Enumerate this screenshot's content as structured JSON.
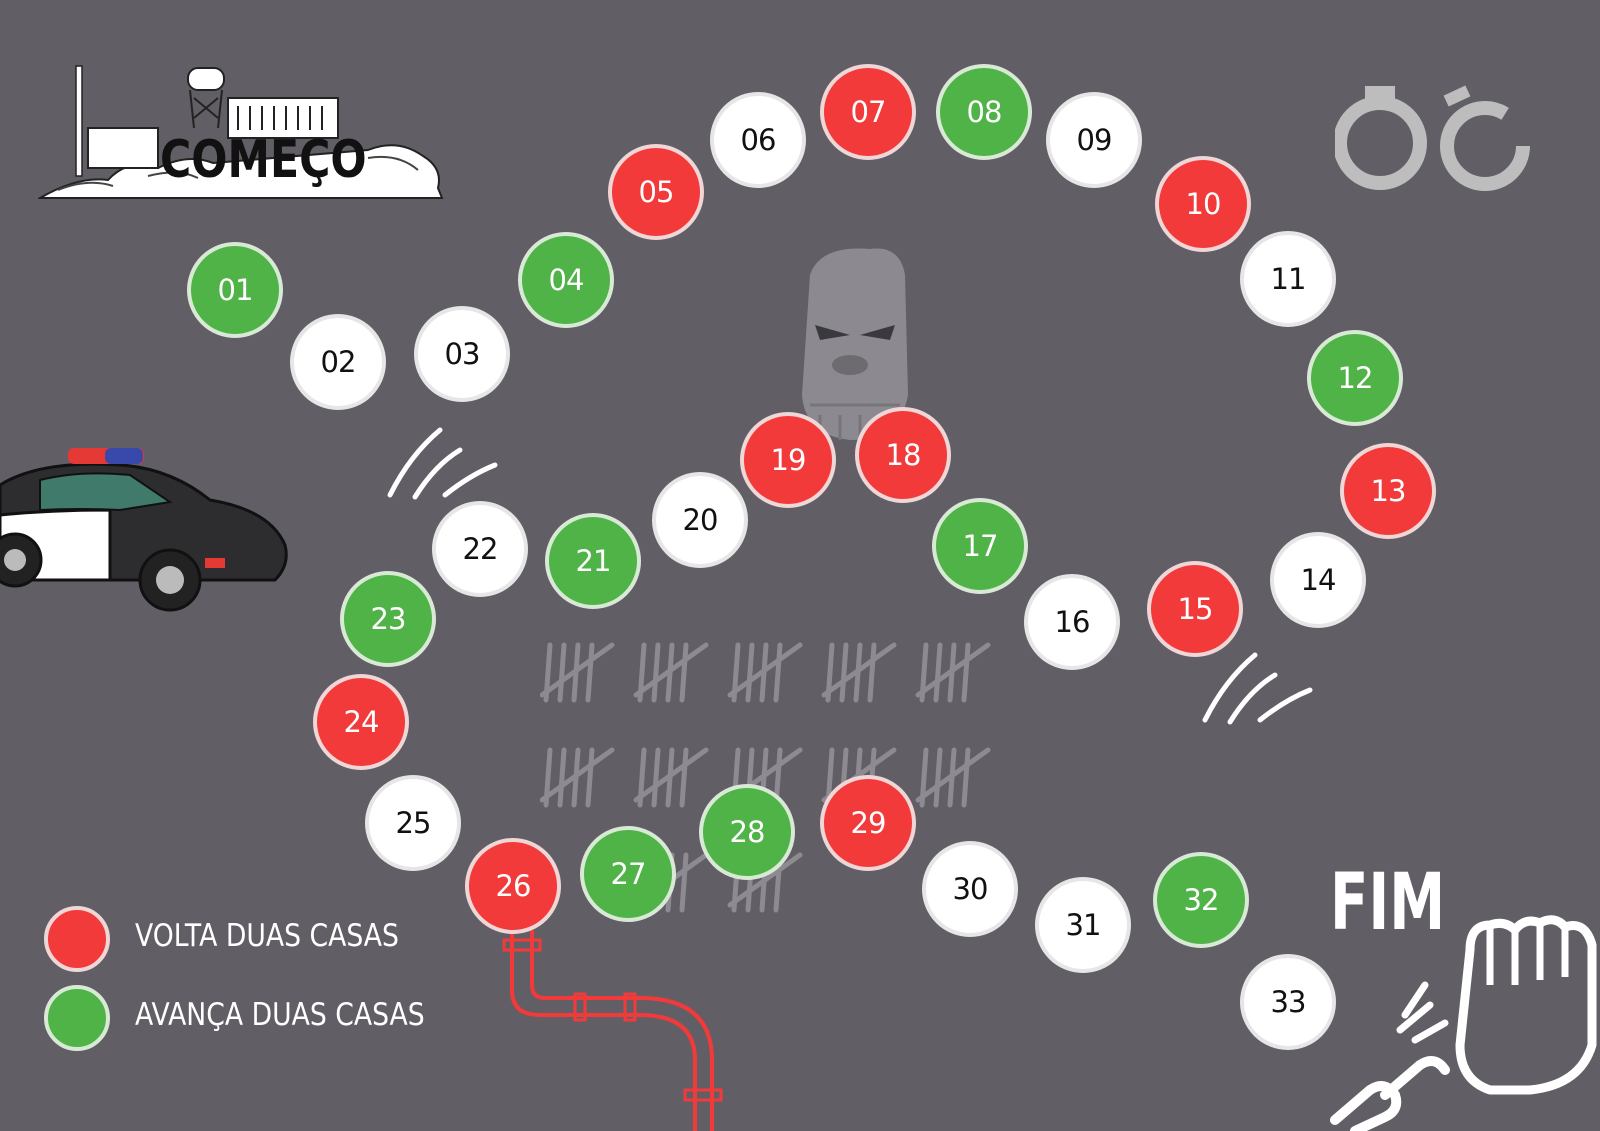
{
  "start_label": "COMEÇO",
  "end_label": "FIM",
  "spaces": [
    {
      "label": "01",
      "type": "green"
    },
    {
      "label": "02",
      "type": "white"
    },
    {
      "label": "03",
      "type": "white"
    },
    {
      "label": "04",
      "type": "green"
    },
    {
      "label": "05",
      "type": "red"
    },
    {
      "label": "06",
      "type": "white"
    },
    {
      "label": "07",
      "type": "red"
    },
    {
      "label": "08",
      "type": "green"
    },
    {
      "label": "09",
      "type": "white"
    },
    {
      "label": "10",
      "type": "red"
    },
    {
      "label": "11",
      "type": "white"
    },
    {
      "label": "12",
      "type": "green"
    },
    {
      "label": "13",
      "type": "red"
    },
    {
      "label": "14",
      "type": "white"
    },
    {
      "label": "15",
      "type": "red"
    },
    {
      "label": "16",
      "type": "white"
    },
    {
      "label": "17",
      "type": "green"
    },
    {
      "label": "18",
      "type": "red"
    },
    {
      "label": "19",
      "type": "red"
    },
    {
      "label": "20",
      "type": "white"
    },
    {
      "label": "21",
      "type": "green"
    },
    {
      "label": "22",
      "type": "white"
    },
    {
      "label": "23",
      "type": "green"
    },
    {
      "label": "24",
      "type": "red"
    },
    {
      "label": "25",
      "type": "white"
    },
    {
      "label": "26",
      "type": "red"
    },
    {
      "label": "27",
      "type": "green"
    },
    {
      "label": "28",
      "type": "green"
    },
    {
      "label": "29",
      "type": "red"
    },
    {
      "label": "30",
      "type": "white"
    },
    {
      "label": "31",
      "type": "white"
    },
    {
      "label": "32",
      "type": "green"
    },
    {
      "label": "33",
      "type": "white"
    }
  ],
  "legend": {
    "back": {
      "label": "VOLTA DUAS CASAS",
      "color": "#f23a3a"
    },
    "forward": {
      "label": "AVANÇA DUAS CASAS",
      "color": "#4fb347"
    }
  },
  "colors": {
    "background": "#625e66",
    "red": "#f23a3a",
    "green": "#4fb347",
    "white": "#ffffff"
  },
  "icons": [
    "prison-island-icon",
    "handcuffs-icon",
    "robber-mask-icon",
    "police-car-icon",
    "tally-marks-icon",
    "pipe-icon",
    "broken-chain-fist-icon"
  ]
}
